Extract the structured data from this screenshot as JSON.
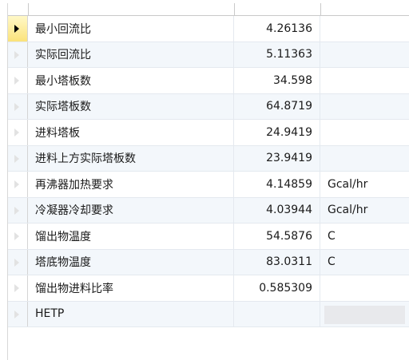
{
  "rows": [
    {
      "name": "最小回流比",
      "value": "4.26136",
      "unit": ""
    },
    {
      "name": "实际回流比",
      "value": "5.11363",
      "unit": ""
    },
    {
      "name": "最小塔板数",
      "value": "34.598",
      "unit": ""
    },
    {
      "name": "实际塔板数",
      "value": "64.8719",
      "unit": ""
    },
    {
      "name": "进料塔板",
      "value": "24.9419",
      "unit": ""
    },
    {
      "name": "进料上方实际塔板数",
      "value": "23.9419",
      "unit": ""
    },
    {
      "name": "再沸器加热要求",
      "value": "4.14859",
      "unit": "Gcal/hr"
    },
    {
      "name": "冷凝器冷却要求",
      "value": "4.03944",
      "unit": "Gcal/hr"
    },
    {
      "name": "馏出物温度",
      "value": "54.5876",
      "unit": "C"
    },
    {
      "name": "塔底物温度",
      "value": "83.0311",
      "unit": "C"
    },
    {
      "name": "馏出物进料比率",
      "value": "0.585309",
      "unit": ""
    },
    {
      "name": "HETP",
      "value": "",
      "unit": ""
    }
  ],
  "colors": {
    "alt_row": "#f3f7fb",
    "selected_row_header": "#fbe37a",
    "grid_line": "#e4e9ef"
  }
}
